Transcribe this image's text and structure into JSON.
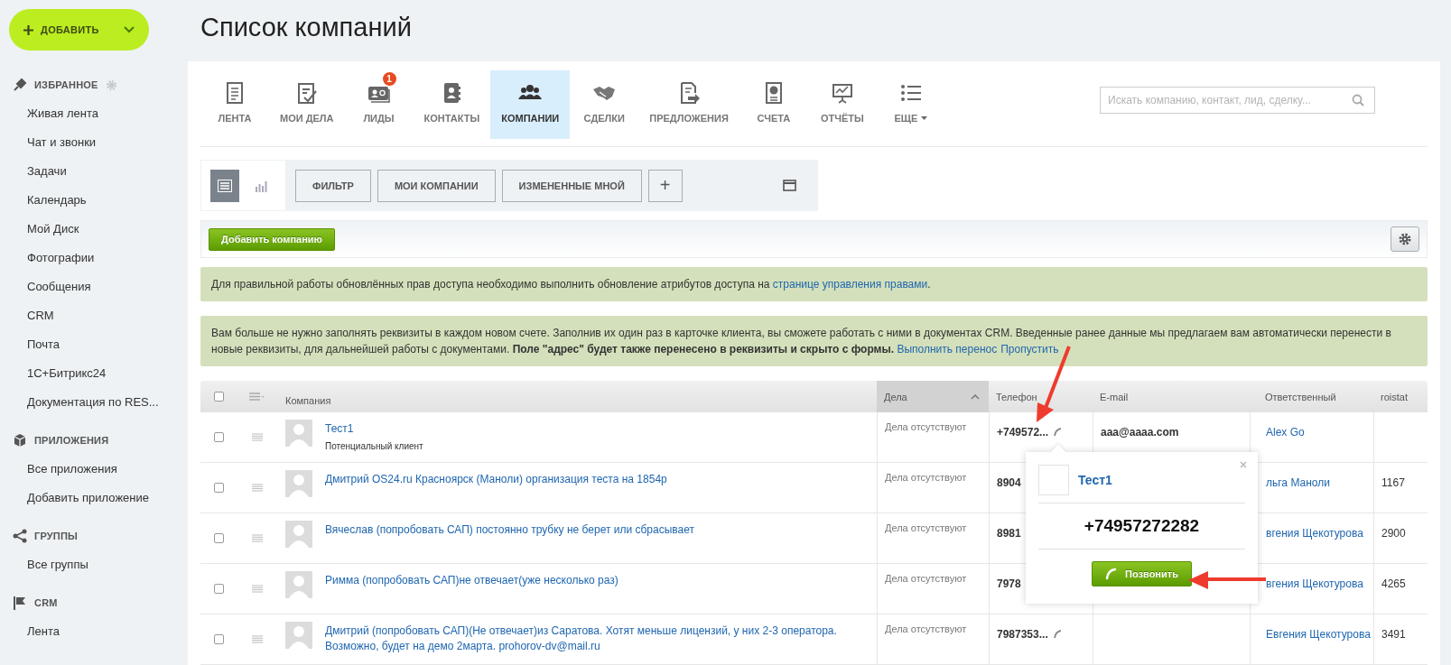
{
  "add_button": {
    "label": "ДОБАВИТЬ"
  },
  "sidebar": {
    "sections": [
      {
        "title": "ИЗБРАННОЕ",
        "settings": true,
        "items": [
          "Живая лента",
          "Чат и звонки",
          "Задачи",
          "Календарь",
          "Мой Диск",
          "Фотографии",
          "Сообщения",
          "CRM",
          "Почта",
          "1С+Битрикс24",
          "Документация по RES..."
        ]
      },
      {
        "title": "ПРИЛОЖЕНИЯ",
        "settings": false,
        "items": [
          "Все приложения",
          "Добавить приложение"
        ]
      },
      {
        "title": "ГРУППЫ",
        "settings": false,
        "items": [
          "Все группы"
        ]
      },
      {
        "title": "CRM",
        "settings": false,
        "items": [
          "Лента"
        ]
      }
    ]
  },
  "page_title": "Список компаний",
  "nav_tabs": [
    {
      "label": "ЛЕНТА",
      "selected": false
    },
    {
      "label": "МОИ ДЕЛА",
      "selected": false
    },
    {
      "label": "ЛИДЫ",
      "selected": false,
      "badge": "1"
    },
    {
      "label": "КОНТАКТЫ",
      "selected": false
    },
    {
      "label": "КОМПАНИИ",
      "selected": true
    },
    {
      "label": "СДЕЛКИ",
      "selected": false
    },
    {
      "label": "ПРЕДЛОЖЕНИЯ",
      "selected": false
    },
    {
      "label": "СЧЕТА",
      "selected": false
    },
    {
      "label": "ОТЧЁТЫ",
      "selected": false
    },
    {
      "label": "ЕЩЕ",
      "selected": false,
      "kind": "menu"
    }
  ],
  "search": {
    "placeholder": "Искать компанию, контакт, лид, сделку..."
  },
  "filter_bar": {
    "view_modes": [
      {
        "selected": true
      },
      {
        "selected": false
      }
    ],
    "presets": [
      "ФИЛЬТР",
      "МОИ КОМПАНИИ",
      "ИЗМЕНЕННЫЕ МНОЙ"
    ],
    "add_preset": "+"
  },
  "toolbar": {
    "add_company": "Добавить компанию"
  },
  "notices": [
    {
      "segments": [
        {
          "kind": "text",
          "text": "Для правильной работы обновлённых прав доступа необходимо выполнить обновление атрибутов доступа на "
        },
        {
          "kind": "link",
          "text": "странице управления правами"
        },
        {
          "kind": "text",
          "text": "."
        }
      ]
    },
    {
      "segments": [
        {
          "kind": "text",
          "text": "Вам больше не нужно заполнять реквизиты в каждом новом счете. Заполнив их один раз в карточке клиента, вы сможете работать с ними в документах CRM. Введенные ранее данные мы предлагаем вам автоматически перенести в новые реквизиты, для дальнейшей работы с документами. **Поле \"адрес\" будет также перенесено в реквизиты и скрыто с формы.** "
        },
        {
          "kind": "link",
          "text": "Выполнить перенос"
        },
        {
          "kind": "link",
          "text": "Пропустить"
        }
      ]
    }
  ],
  "table": {
    "select_all_checked": false,
    "columns": [
      {
        "label": "Компания",
        "sorted": false
      },
      {
        "label": "Дела",
        "sorted": true
      },
      {
        "label": "Телефон",
        "sorted": false
      },
      {
        "label": "E-mail",
        "sorted": false
      },
      {
        "label": "Ответственный",
        "sorted": false
      },
      {
        "label": "roistat",
        "sorted": false
      }
    ],
    "rows": [
      {
        "checked": false,
        "name": "Тест1",
        "subtitle": "Потенциальный клиент",
        "deals": "Дела отсутствуют",
        "phone": "+749572...",
        "call_icon": true,
        "email": "aaa@aaaa.com",
        "responsible": "Alex Go"
      },
      {
        "checked": false,
        "name": "Дмитрий OS24.ru Красноярск (Маноли) организация теста на 1854р",
        "deals": "Дела отсутствуют",
        "phone": "8904",
        "responsible": "льга Маноли",
        "roistat": "1167"
      },
      {
        "checked": false,
        "name": "Вячеслав (попробовать САП) постоянно трубку не берет или сбрасывает",
        "deals": "Дела отсутствуют",
        "phone": "8981",
        "responsible": "вгения Щекотурова",
        "roistat": "2900"
      },
      {
        "checked": false,
        "name": "Римма (попробовать САП)не отвечает(уже несколько раз)",
        "deals": "Дела отсутствуют",
        "phone": "7978",
        "responsible": "вгения Щекотурова",
        "roistat": "4265"
      },
      {
        "checked": false,
        "name": "Дмитрий (попробовать САП)(Не отвечает)из Саратова. Хотят меньше лицензий, у них 2-3 оператора. Возможно, будет на демо 2марта. prohorov-dv@mail.ru",
        "deals": "Дела отсутствуют",
        "phone": "7987353...",
        "call_icon": true,
        "responsible": "Евгения Щекотурова",
        "roistat": "3491"
      }
    ]
  },
  "call_popup": {
    "name": "Тест1",
    "phone": "+74957272282",
    "button": "Позвонить"
  }
}
